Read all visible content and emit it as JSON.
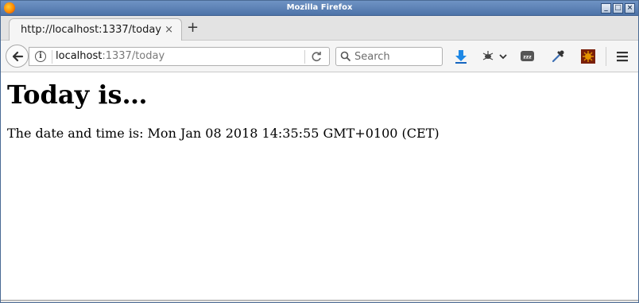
{
  "window": {
    "title": "Mozilla Firefox"
  },
  "tab": {
    "title": "http://localhost:1337/today",
    "close_glyph": "×"
  },
  "new_tab_glyph": "+",
  "url": {
    "host": "localhost",
    "rest": ":1337/today",
    "info_glyph": "i"
  },
  "search": {
    "placeholder": "Search"
  },
  "wm": {
    "minimize": "_",
    "maximize": "□",
    "close": "×"
  },
  "page": {
    "heading": "Today is…",
    "date_line": "The date and time is: Mon Jan 08 2018 14:35:55 GMT+0100 (CET)"
  },
  "icons": {
    "downloads": "download-arrow-icon",
    "extension": "bug-extension-icon",
    "sleep": "zzz-sleep-icon",
    "eyedropper": "eyedropper-icon",
    "addon": "sun-addon-icon",
    "menu": "hamburger-menu-icon"
  },
  "colors": {
    "titlebar": "#5a7fb4",
    "download_blue": "#1e88e5",
    "addon_orange": "#e59400"
  }
}
